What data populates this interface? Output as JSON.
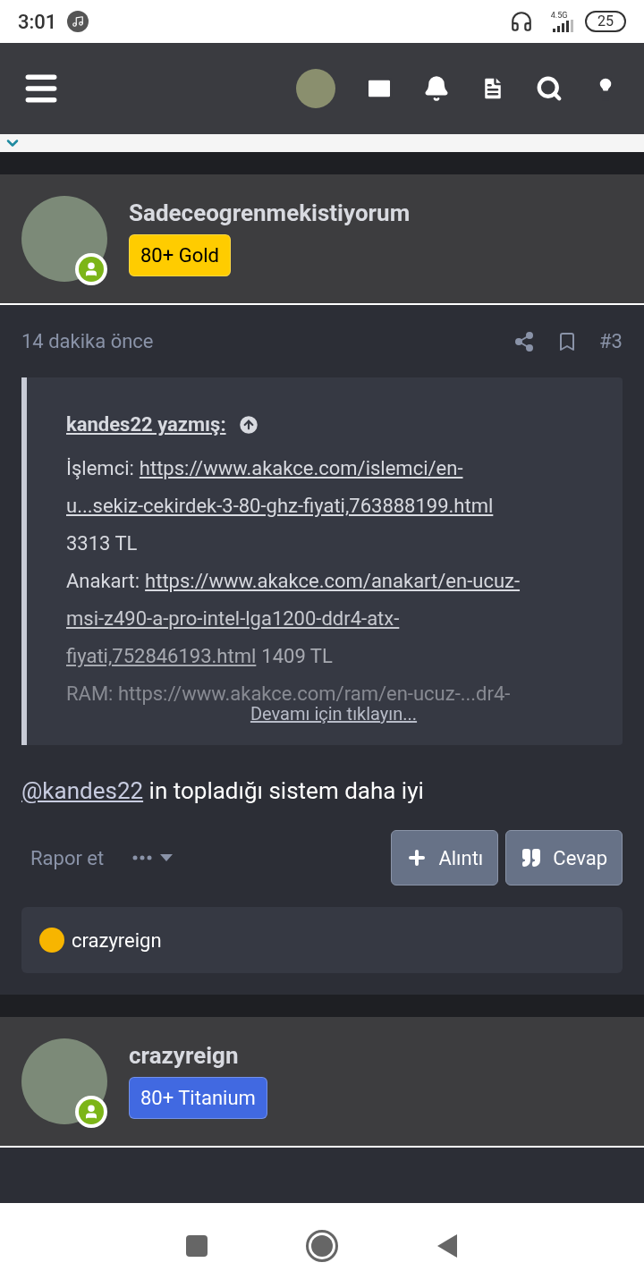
{
  "status_bar": {
    "time": "3:01",
    "network": "4.5G",
    "battery": "25"
  },
  "posts": [
    {
      "author": "Sadeceogrenmekistiyorum",
      "badge": {
        "text": "80+ Gold",
        "color": "#ffcc00"
      },
      "online": true,
      "time": "14 dakika önce",
      "number": "#3",
      "quote": {
        "author": "kandes22 yazmış:",
        "lines": [
          [
            {
              "kind": "text",
              "text": "İşlemci:"
            },
            {
              "kind": "link",
              "text": "https://www.akakce.com/islemci/en-"
            }
          ],
          [
            {
              "kind": "link",
              "text": "u...sekiz-cekirdek-3-80-ghz-fiyati,763888199.html"
            }
          ],
          [
            {
              "kind": "text",
              "text": "3313 TL"
            }
          ],
          [
            {
              "kind": "text",
              "text": "Anakart:"
            },
            {
              "kind": "link",
              "text": "https://www.akakce.com/anakart/en-ucuz-"
            }
          ],
          [
            {
              "kind": "link",
              "text": "msi-z490-a-pro-intel-lga1200-ddr4-atx-"
            }
          ],
          [
            {
              "kind": "link",
              "text": "fiyati,752846193.html"
            },
            {
              "kind": "text",
              "text": "1409 TL"
            }
          ],
          [
            {
              "kind": "text",
              "text": "RAM: https://www.akakce.com/ram/en-ucuz-...dr4-"
            }
          ]
        ],
        "expand": "Devamı için tıklayın..."
      },
      "body": [
        {
          "kind": "link",
          "text": "@kandes22"
        },
        {
          "kind": "text",
          "text": " in topladığı sistem daha iyi"
        }
      ],
      "report": "Rapor et",
      "quote_button": "Alıntı",
      "reply_button": "Cevap",
      "reactions": [
        "crazyreign"
      ]
    }
  ],
  "next_author": {
    "author": "crazyreign",
    "badge": {
      "text": "80+ Titanium",
      "color": "#4169e1"
    },
    "online": true
  }
}
